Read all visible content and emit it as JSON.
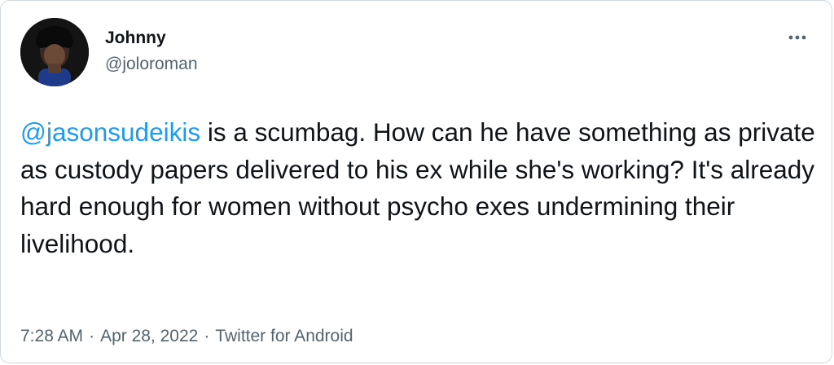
{
  "author": {
    "display_name": "Johnny",
    "handle": "@joloroman"
  },
  "tweet": {
    "mention": "@jasonsudeikis",
    "text": " is a scumbag. How can he have something as private as custody papers delivered to his ex while she's working? It's already hard enough for women without psycho exes undermining their livelihood."
  },
  "meta": {
    "time": "7:28 AM",
    "separator": "·",
    "date": "Apr 28, 2022",
    "source": "Twitter for Android"
  },
  "colors": {
    "text": "#0f1419",
    "secondary": "#536471",
    "link": "#1d9bf0",
    "border": "#cfd9de"
  },
  "icons": {
    "more": "more-horizontal-icon"
  }
}
